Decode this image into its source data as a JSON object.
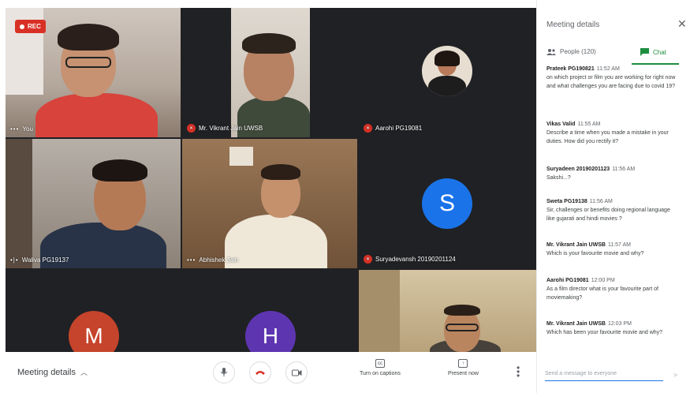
{
  "recording": {
    "label": "REC"
  },
  "tiles": {
    "you": {
      "label": "You"
    },
    "vikrant": {
      "label": "Mr. Vikrant Jain UWSB"
    },
    "aarohi": {
      "label": "Aarohi PG19081"
    },
    "waliva": {
      "label": "Waliva PG19137"
    },
    "abhishek": {
      "label": "Abhishek Jain"
    },
    "suryadevansh": {
      "label": "Suryadevansh 20190201124",
      "avatar_letter": "S",
      "avatar_color": "#1a73e8"
    },
    "m": {
      "avatar_letter": "M",
      "avatar_color": "#c5442b"
    },
    "h": {
      "avatar_letter": "H",
      "avatar_color": "#5e35b1"
    }
  },
  "bottombar": {
    "meeting_details": "Meeting details",
    "captions": "Turn on captions",
    "present": "Present now"
  },
  "panel": {
    "title": "Meeting details",
    "tab_people": "People (120)",
    "tab_chat": "Chat",
    "messages": [
      {
        "sender": "Prateek PG190821",
        "time": "11:52 AM",
        "text": "on which project or film you are working for right now and what challenges you are facing due to covid 19?"
      },
      {
        "sender": "Vikas Valid",
        "time": "11:55 AM",
        "text": "Describe a time when you made a mistake in your duties. How did you rectify it?"
      },
      {
        "sender": "Suryadeen 20190201123",
        "time": "11:56 AM",
        "text": "Sakshi...?"
      },
      {
        "sender": "Sweta PG19138",
        "time": "11:56 AM",
        "text": "Sir, challenges or benefits doing regional language like gujarati and hindi movies ?"
      },
      {
        "sender": "Mr. Vikrant Jain UWSB",
        "time": "11:57 AM",
        "text": "Which is your favourite movie and why?"
      },
      {
        "sender": "Aarohi PG19081",
        "time": "12:00 PM",
        "text": "As a film director what is your favourite part of moviemaking?"
      },
      {
        "sender": "Mr. Vikrant Jain UWSB",
        "time": "12:03 PM",
        "text": "Which has been your favourite movie and why?"
      }
    ],
    "input_placeholder": "Send a message to everyone"
  },
  "colors": {
    "accent": "#1e8e3e",
    "danger": "#d93025",
    "tile_bg": "#202124"
  }
}
